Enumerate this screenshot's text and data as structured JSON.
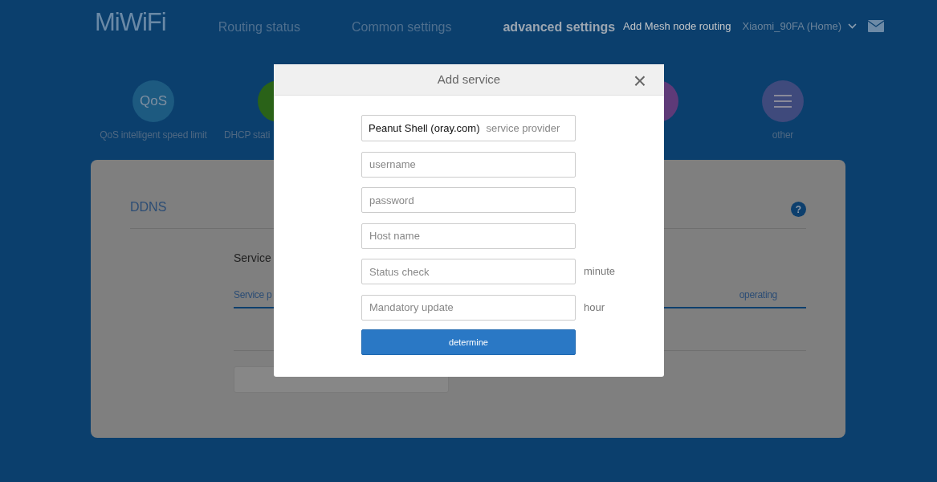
{
  "header": {
    "logo": "MiWiFi",
    "nav": [
      {
        "label": "Routing status",
        "selected": false
      },
      {
        "label": "Common settings",
        "selected": false
      },
      {
        "label": "advanced settings",
        "selected": true
      }
    ],
    "mesh_link": "Add Mesh node routing",
    "router": "Xiaomi_90FA (Home)"
  },
  "features_left": [
    {
      "kind": "text",
      "icon_text": "QoS",
      "label": "QoS intelligent speed limit",
      "color": "#1d5a80"
    },
    {
      "kind": "blank",
      "label": "DHCP stati",
      "color": "#2a6218"
    }
  ],
  "features_right": [
    {
      "kind": "blank",
      "color": "#5e3a78"
    },
    {
      "kind": "menu",
      "label": "other",
      "color": "#3f4a7c"
    }
  ],
  "ddns": {
    "title": "DDNS",
    "help": "?",
    "list_title": "Service",
    "columns": [
      "Service p",
      "operating"
    ]
  },
  "modal": {
    "title": "Add service",
    "close": "×",
    "provider": {
      "value": "Peanut Shell (oray.com)",
      "label": "service provider"
    },
    "fields": [
      {
        "placeholder": "username"
      },
      {
        "placeholder": "password"
      },
      {
        "placeholder": "Host name"
      },
      {
        "placeholder": "Status check",
        "unit": "minute"
      },
      {
        "placeholder": "Mandatory update",
        "unit": "hour"
      }
    ],
    "submit": "determine"
  }
}
